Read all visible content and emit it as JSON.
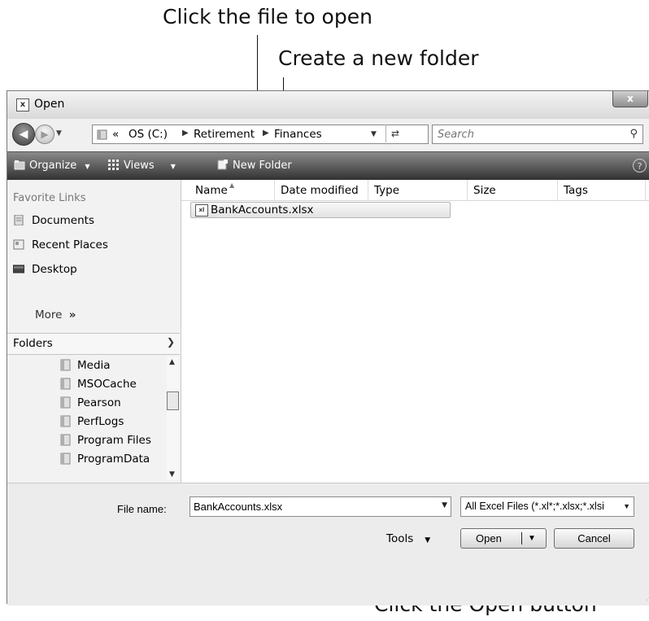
{
  "callouts": {
    "file": "Click the file to open",
    "folder": "Create a new folder",
    "open": "Click the Open button"
  },
  "window": {
    "title": "Open",
    "close": "x"
  },
  "nav": {
    "back_icon": "back-arrow-icon",
    "forward_icon": "forward-arrow-icon",
    "breadcrumb": [
      "«",
      "OS (C:)",
      "Retirement",
      "Finances"
    ],
    "search_placeholder": "Search"
  },
  "toolbar": {
    "organize": "Organize",
    "views": "Views",
    "new_folder": "New Folder",
    "help": "?"
  },
  "favorites": {
    "header": "Favorite Links",
    "items": [
      "Documents",
      "Recent Places",
      "Desktop"
    ],
    "more": "More",
    "more_arrow": "»"
  },
  "folders": {
    "label": "Folders",
    "items": [
      "Media",
      "MSOCache",
      "Pearson",
      "PerfLogs",
      "Program Files",
      "ProgramData"
    ]
  },
  "columns": [
    "Name",
    "Date modified",
    "Type",
    "Size",
    "Tags"
  ],
  "files": [
    {
      "name": "BankAccounts.xlsx",
      "icon": "excel-file-icon",
      "selected": true
    }
  ],
  "footer": {
    "file_name_label": "File name:",
    "file_name_value": "BankAccounts.xlsx",
    "filter_value": "All Excel Files (*.xl*;*.xlsx;*.xlsi",
    "tools": "Tools",
    "open": "Open",
    "cancel": "Cancel"
  }
}
